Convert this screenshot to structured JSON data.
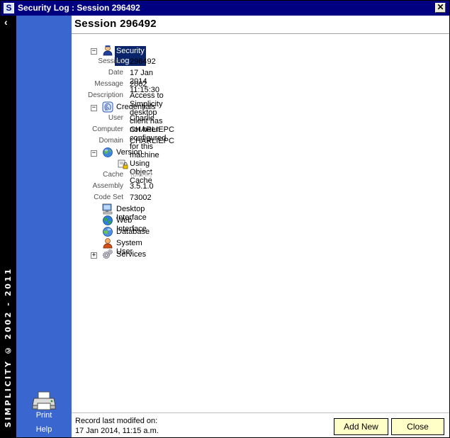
{
  "window": {
    "title": "Security Log : Session 296492",
    "app_icon": "S",
    "close_glyph": "✕"
  },
  "brand": {
    "collapse_glyph": "‹",
    "text": "SIMPLICITY © 2002 - 2011"
  },
  "sidebar": {
    "print_label": "Print",
    "help_label": "Help"
  },
  "content": {
    "session_title": "Session 296492"
  },
  "tree": {
    "security_log": {
      "label": "Security Log",
      "icon": "user-icon",
      "props": [
        {
          "key": "Session",
          "value": "296492"
        },
        {
          "key": "Date",
          "value": "17 Jan 2014 11:15:30"
        },
        {
          "key": "Message",
          "value": "2002"
        },
        {
          "key": "Description",
          "value": "Access to Simplicity desktop client has not been configured for this machine"
        }
      ]
    },
    "credentials": {
      "label": "Credentials",
      "icon": "fingerprint-icon",
      "props": [
        {
          "key": "User",
          "value": "Charlie"
        },
        {
          "key": "Computer",
          "value": "CHARLIEPC"
        },
        {
          "key": "Domain",
          "value": "CHARLIEPC"
        }
      ]
    },
    "version": {
      "label": "Version",
      "icon": "globe-icon",
      "cache_note": "Using Object Cache",
      "props": [
        {
          "key": "Cache",
          "value": "{blank}"
        },
        {
          "key": "Assembly",
          "value": "3.5.1.0"
        },
        {
          "key": "Code Set",
          "value": "73002"
        }
      ]
    },
    "others": [
      {
        "label": "Desktop Interface",
        "icon": "desktop-icon"
      },
      {
        "label": "Web Interface",
        "icon": "web-globe-icon"
      },
      {
        "label": "Database",
        "icon": "database-icon"
      },
      {
        "label": "System User",
        "icon": "system-user-icon"
      },
      {
        "label": "Services",
        "icon": "gears-icon"
      }
    ],
    "collapse_glyph": "−",
    "expand_glyph": "+"
  },
  "footer": {
    "modified_line1": "Record last modifed on:",
    "modified_line2": "17 Jan 2014, 11:15 a.m.",
    "add_new_label": "Add New",
    "close_label": "Close"
  }
}
